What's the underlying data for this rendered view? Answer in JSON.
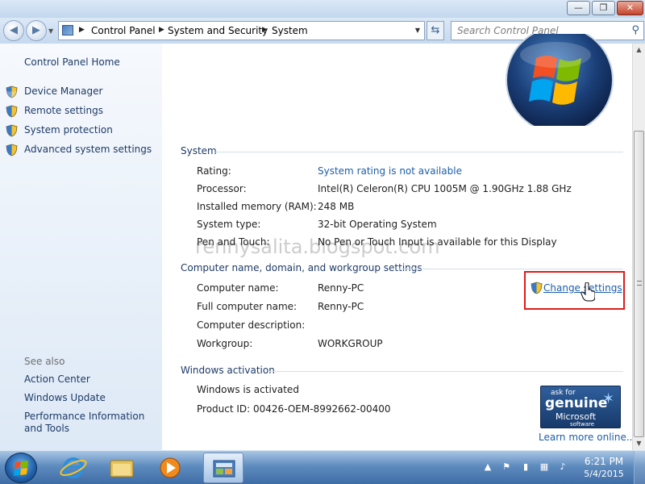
{
  "window": {
    "minimize": "—",
    "maximize": "❐",
    "close": "✕"
  },
  "address": {
    "breadcrumbs": [
      "Control Panel",
      "System and Security",
      "System"
    ],
    "search_placeholder": "Search Control Panel"
  },
  "sidebar": {
    "home": "Control Panel Home",
    "tasks": [
      "Device Manager",
      "Remote settings",
      "System protection",
      "Advanced system settings"
    ],
    "see_also_header": "See also",
    "see_also": [
      "Action Center",
      "Windows Update",
      "Performance Information and Tools"
    ]
  },
  "system": {
    "header": "System",
    "rating_label": "Rating:",
    "rating_value": "System rating is not available",
    "processor_label": "Processor:",
    "processor_value": "Intel(R) Celeron(R) CPU 1005M @ 1.90GHz   1.88 GHz",
    "memory_label": "Installed memory (RAM):",
    "memory_value": "248 MB",
    "type_label": "System type:",
    "type_value": "32-bit Operating System",
    "pen_label": "Pen and Touch:",
    "pen_value": "No Pen or Touch Input is available for this Display"
  },
  "computer": {
    "header": "Computer name, domain, and workgroup settings",
    "name_label": "Computer name:",
    "name_value": "Renny-PC",
    "full_label": "Full computer name:",
    "full_value": "Renny-PC",
    "desc_label": "Computer description:",
    "workgroup_label": "Workgroup:",
    "workgroup_value": "WORKGROUP",
    "change_settings": "Change settings"
  },
  "activation": {
    "header": "Windows activation",
    "status": "Windows is activated",
    "product_id": "Product ID:  00426-OEM-8992662-00400",
    "badge_ask": "ask for",
    "badge_genuine": "genuine",
    "badge_microsoft": "Microsoft",
    "badge_software": "software",
    "learn_more": "Learn more online..."
  },
  "watermark": "rennysalita.blogspot.com",
  "taskbar": {
    "time": "6:21 PM",
    "date": "5/4/2015"
  },
  "colors": {
    "link": "#1c5ea8",
    "highlight": "#e01b1b",
    "sidebar_link": "#1e3a66"
  }
}
